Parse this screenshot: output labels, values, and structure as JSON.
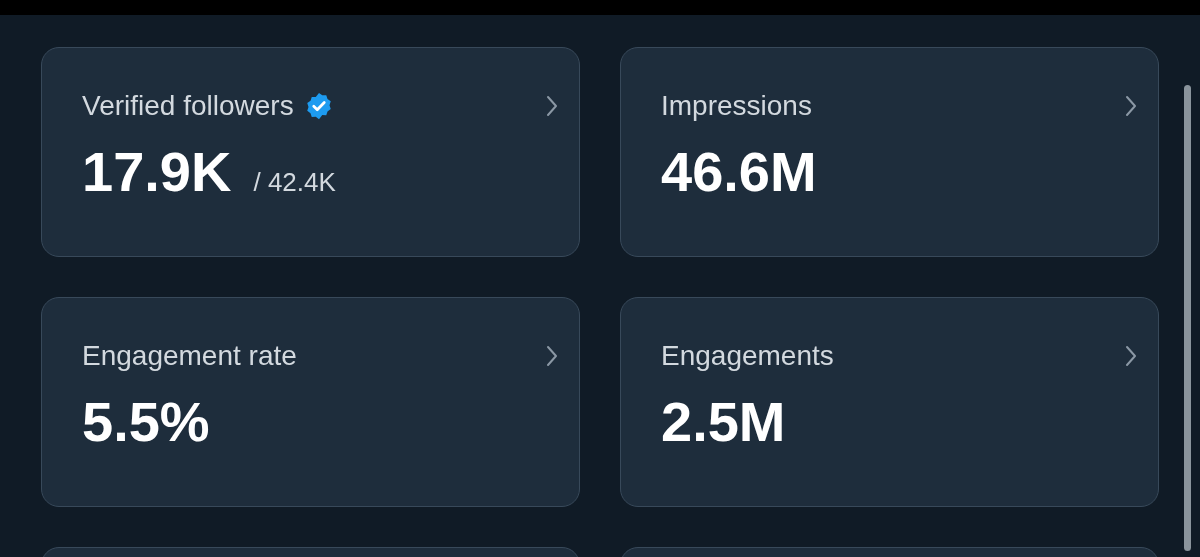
{
  "cards": [
    {
      "title": "Verified followers",
      "verified": true,
      "value": "17.9K",
      "total": "/ 42.4K"
    },
    {
      "title": "Impressions",
      "verified": false,
      "value": "46.6M"
    },
    {
      "title": "Engagement rate",
      "verified": false,
      "value": "5.5%"
    },
    {
      "title": "Engagements",
      "verified": false,
      "value": "2.5M"
    }
  ]
}
